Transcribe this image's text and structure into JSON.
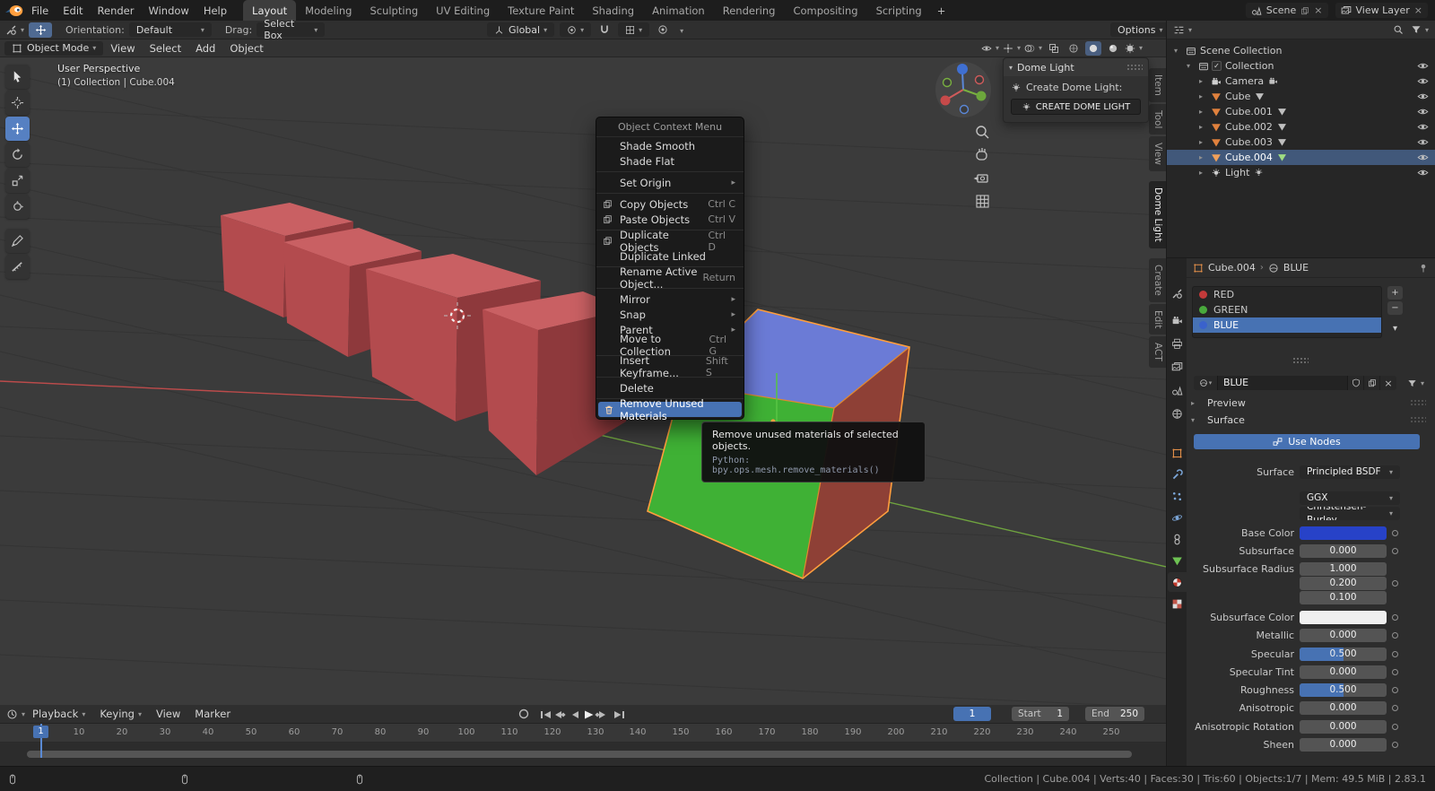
{
  "topbar": {
    "menus": [
      "File",
      "Edit",
      "Render",
      "Window",
      "Help"
    ],
    "workspaces": [
      "Layout",
      "Modeling",
      "Sculpting",
      "UV Editing",
      "Texture Paint",
      "Shading",
      "Animation",
      "Rendering",
      "Compositing",
      "Scripting"
    ],
    "active_workspace": "Layout",
    "add_workspace": "+",
    "scene": "Scene",
    "view_layer": "View Layer"
  },
  "tool_settings": {
    "orientation_label": "Orientation:",
    "orientation": "Default",
    "drag_label": "Drag:",
    "drag": "Select Box",
    "transform_space": "Global",
    "options": "Options"
  },
  "viewport": {
    "mode": "Object Mode",
    "menus": [
      "View",
      "Select",
      "Add",
      "Object"
    ],
    "view_label": "User Perspective",
    "active_label": "(1) Collection | Cube.004"
  },
  "sidebar_tabs": {
    "items": [
      "Item",
      "Tool",
      "View",
      "Dome Light",
      "Create",
      "Edit",
      "ACT"
    ],
    "active": "Dome Light"
  },
  "dome_light": {
    "title": "Dome Light",
    "label": "Create Dome Light:",
    "button": "CREATE DOME LIGHT"
  },
  "context_menu": {
    "title": "Object Context Menu",
    "highlighted": "Remove Unused Materials",
    "items": [
      {
        "label": "Shade Smooth"
      },
      {
        "label": "Shade Flat"
      },
      {
        "label": "Set Origin"
      },
      {
        "label": "Copy Objects",
        "shortcut": "Ctrl C"
      },
      {
        "label": "Paste Objects",
        "shortcut": "Ctrl V"
      },
      {
        "label": "Duplicate Objects",
        "shortcut": "Ctrl D"
      },
      {
        "label": "Duplicate Linked"
      },
      {
        "label": "Rename Active Object...",
        "shortcut": "Return"
      },
      {
        "label": "Mirror"
      },
      {
        "label": "Snap"
      },
      {
        "label": "Parent"
      },
      {
        "label": "Move to Collection",
        "shortcut": "Ctrl G"
      },
      {
        "label": "Insert Keyframe...",
        "shortcut": "Shift S"
      },
      {
        "label": "Delete"
      },
      {
        "label": "Remove Unused Materials"
      }
    ]
  },
  "tooltip": {
    "text": "Remove unused materials of selected objects.",
    "python": "Python: bpy.ops.mesh.remove_materials()"
  },
  "outliner": {
    "root": "Scene Collection",
    "collection": "Collection",
    "objects": [
      {
        "name": "Camera",
        "type": "camera"
      },
      {
        "name": "Cube",
        "type": "mesh"
      },
      {
        "name": "Cube.001",
        "type": "mesh"
      },
      {
        "name": "Cube.002",
        "type": "mesh"
      },
      {
        "name": "Cube.003",
        "type": "mesh"
      },
      {
        "name": "Cube.004",
        "type": "mesh",
        "selected": true
      },
      {
        "name": "Light",
        "type": "light"
      }
    ]
  },
  "properties": {
    "breadcrumb_object": "Cube.004",
    "breadcrumb_material": "BLUE",
    "slots": [
      {
        "name": "RED",
        "color": "#c23a3a"
      },
      {
        "name": "GREEN",
        "color": "#49a93c"
      },
      {
        "name": "BLUE",
        "color": "#3a62cc",
        "selected": true
      }
    ],
    "material_name": "BLUE",
    "sections": {
      "preview": "Preview",
      "surface": "Surface"
    },
    "use_nodes": "Use Nodes",
    "surface_label": "Surface",
    "shader": "Principled BSDF",
    "distribution": "GGX",
    "subsurface_method": "Christensen-Burley",
    "params": [
      {
        "label": "Base Color",
        "type": "color",
        "value": "#2742c8"
      },
      {
        "label": "Subsurface",
        "type": "number",
        "value": "0.000"
      },
      {
        "label": "Subsurface Radius",
        "type": "vector",
        "values": [
          "1.000",
          "0.200",
          "0.100"
        ]
      },
      {
        "label": "Subsurface Color",
        "type": "color",
        "value": "#f0f0f0"
      },
      {
        "label": "Metallic",
        "type": "number",
        "value": "0.000"
      },
      {
        "label": "Specular",
        "type": "slider",
        "value": "0.500",
        "fill": "50%"
      },
      {
        "label": "Specular Tint",
        "type": "number",
        "value": "0.000"
      },
      {
        "label": "Roughness",
        "type": "slider",
        "value": "0.500",
        "fill": "50%"
      },
      {
        "label": "Anisotropic",
        "type": "number",
        "value": "0.000"
      },
      {
        "label": "Anisotropic Rotation",
        "type": "number",
        "value": "0.000"
      },
      {
        "label": "Sheen",
        "type": "number",
        "value": "0.000"
      }
    ]
  },
  "timeline": {
    "menus": [
      "Playback",
      "Keying",
      "View",
      "Marker"
    ],
    "current_frame": "1",
    "start_label": "Start",
    "start": "1",
    "end_label": "End",
    "end": "250",
    "ticks": [
      "10",
      "20",
      "30",
      "40",
      "50",
      "60",
      "70",
      "80",
      "90",
      "100",
      "110",
      "120",
      "130",
      "140",
      "150",
      "160",
      "170",
      "180",
      "190",
      "200",
      "210",
      "220",
      "230",
      "240",
      "250"
    ]
  },
  "status_bar": {
    "text": "Collection | Cube.004 | Verts:40 | Faces:30 | Tris:60 | Objects:1/7 | Mem: 49.5 MiB | 2.83.1"
  },
  "colors": {
    "accent": "#4772b3",
    "selection_outline": "#ff9e3d",
    "viewport_bg": "#3b3b3b"
  }
}
